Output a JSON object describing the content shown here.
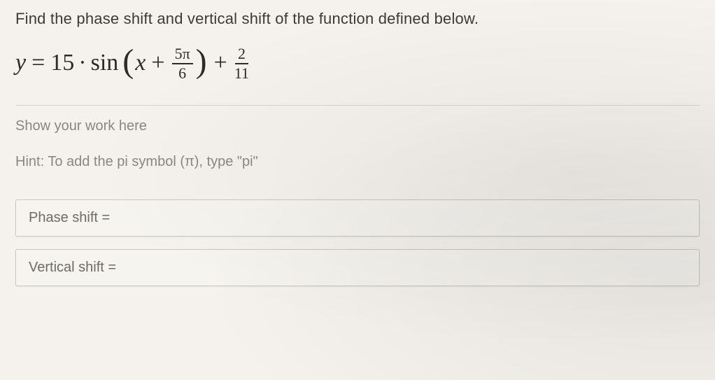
{
  "question": "Find the phase shift and vertical shift of the function defined below.",
  "equation": {
    "lhs": "y",
    "eq": "=",
    "amplitude": "15",
    "dot": "·",
    "func": "sin",
    "lparen": "(",
    "var": "x",
    "plus1": "+",
    "frac1_num": "5π",
    "frac1_den": "6",
    "rparen": ")",
    "plus2": "+",
    "frac2_num": "2",
    "frac2_den": "11"
  },
  "workarea": {
    "placeholder": "Show your work here"
  },
  "hint": "Hint: To add the pi symbol (π), type \"pi\"",
  "answers": {
    "phase_label": "Phase shift =",
    "phase_value": "",
    "vertical_label": "Vertical shift =",
    "vertical_value": ""
  }
}
